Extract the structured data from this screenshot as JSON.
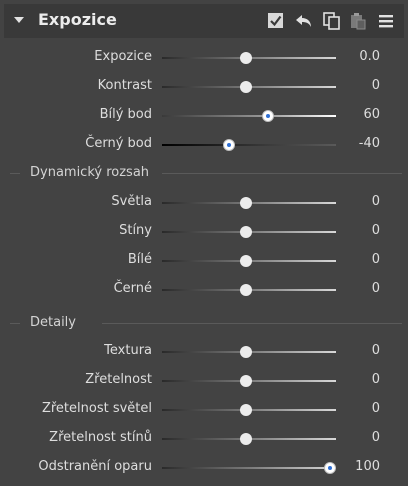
{
  "panel": {
    "title": "Expozice"
  },
  "rows_basic": [
    {
      "label": "Expozice",
      "value": "0.0",
      "position": 0.5
    },
    {
      "label": "Kontrast",
      "value": "0",
      "position": 0.5
    },
    {
      "label": "Bílý bod",
      "value": "60",
      "position": 0.63
    },
    {
      "label": "Černý bod",
      "value": "-40",
      "position": 0.4
    }
  ],
  "section_dynamic": {
    "title": "Dynamický rozsah",
    "rows": [
      {
        "label": "Světla",
        "value": "0",
        "position": 0.5
      },
      {
        "label": "Stíny",
        "value": "0",
        "position": 0.5
      },
      {
        "label": "Bílé",
        "value": "0",
        "position": 0.5
      },
      {
        "label": "Černé",
        "value": "0",
        "position": 0.5
      }
    ]
  },
  "section_details": {
    "title": "Detaily",
    "rows": [
      {
        "label": "Textura",
        "value": "0",
        "position": 0.5
      },
      {
        "label": "Zřetelnost",
        "value": "0",
        "position": 0.5
      },
      {
        "label": "Zřetelnost světel",
        "value": "0",
        "position": 0.5
      },
      {
        "label": "Zřetelnost stínů",
        "value": "0",
        "position": 0.5
      },
      {
        "label": "Odstranění oparu",
        "value": "100",
        "position": 1.0
      }
    ]
  },
  "icons": {
    "collapse": "triangle-down-icon",
    "enable": "checkbox-checked-icon",
    "reset": "undo-icon",
    "copy": "copy-icon",
    "paste": "paste-icon",
    "menu": "hamburger-menu-icon"
  },
  "colors": {
    "background": "#434343",
    "header": "#393939",
    "active_knob_dot": "#2f6fd4"
  }
}
